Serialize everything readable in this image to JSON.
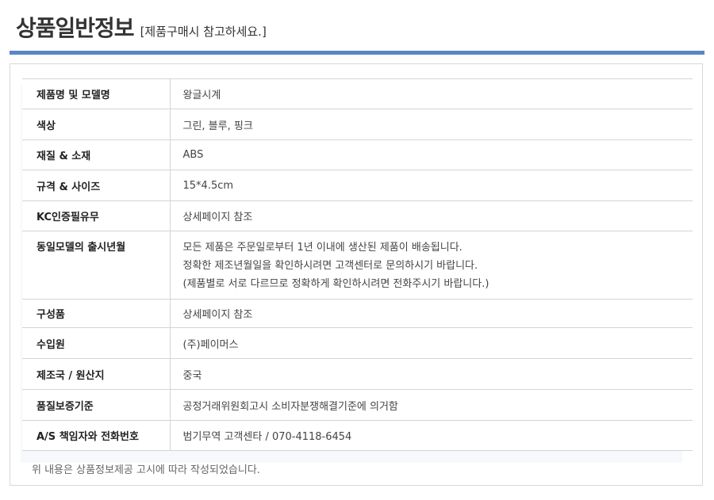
{
  "header": {
    "title": "상품일반정보",
    "subtitle": "[제품구매시 참고하세요.]"
  },
  "colors": {
    "accent_rule": "#5b86c5",
    "border": "#d4d4d4"
  },
  "rows": [
    {
      "label": "제품명 및 모델명",
      "value": "왕글시계"
    },
    {
      "label": "색상",
      "value": "그린, 블루, 핑크"
    },
    {
      "label": "재질 & 소재",
      "value": "ABS"
    },
    {
      "label": "규격 & 사이즈",
      "value": "15*4.5cm"
    },
    {
      "label": "KC인증필유무",
      "value": "상세페이지 참조"
    },
    {
      "label": "동일모델의 출시년월",
      "lines": [
        "모든 제품은 주문일로부터 1년 이내에 생산된 제품이 배송됩니다.",
        "정확한 제조년월일을 확인하시려면 고객센터로 문의하시기 바랍니다.",
        "(제품별로 서로 다르므로 정확하게 확인하시려면 전화주시기 바랍니다.)"
      ]
    },
    {
      "label": "구성품",
      "value": "상세페이지 참조"
    },
    {
      "label": "수입원",
      "value": "(주)페이머스"
    },
    {
      "label": "제조국 / 원산지",
      "value": "중국"
    },
    {
      "label": "품질보증기준",
      "value": "공정거래위원회고시 소비자분쟁해결기준에 의거함"
    },
    {
      "label": "A/S 책임자와 전화번호",
      "value": "범기무역 고객센타 / 070-4118-6454"
    }
  ],
  "footnote": "위 내용은 상품정보제공 고시에 따라 작성되었습니다."
}
